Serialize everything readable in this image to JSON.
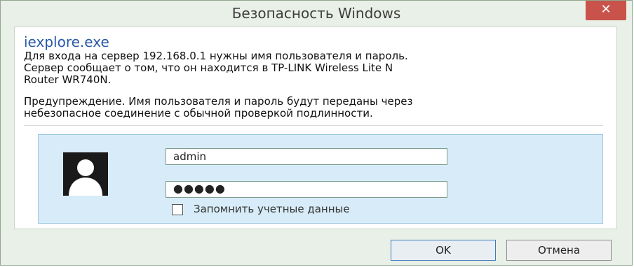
{
  "window": {
    "title": "Безопасность Windows",
    "close_glyph": "✕"
  },
  "message": {
    "app_name": "iexplore.exe",
    "line1": "Для входа на сервер 192.168.0.1 нужны имя пользователя и пароль.",
    "line2": "Сервер сообщает о том, что он находится в TP-LINK Wireless Lite N",
    "line3": "Router WR740N.",
    "warning1": "Предупреждение. Имя пользователя и пароль будут переданы через",
    "warning2": "небезопасное соединение с обычной проверкой подлинности."
  },
  "credentials": {
    "username_value": "admin",
    "password_mask": "●●●●●",
    "remember_label": "Запомнить учетные данные",
    "remember_checked": false
  },
  "buttons": {
    "ok": "OK",
    "cancel": "Отмена"
  },
  "colors": {
    "accent": "#2a5aa8",
    "close_button": "#c9534a",
    "panel": "#d7ecf8"
  },
  "icons": {
    "avatar": "user-avatar-icon",
    "close": "close-icon"
  }
}
